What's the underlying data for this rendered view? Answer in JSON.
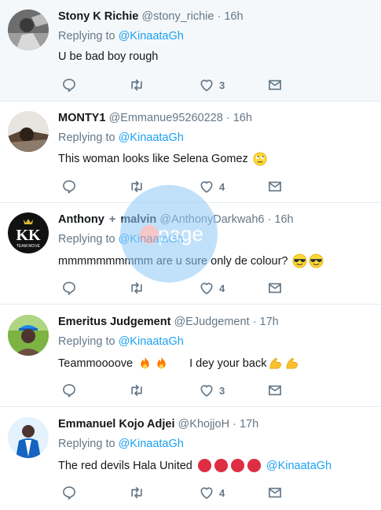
{
  "tweets": [
    {
      "name": "Stony K Richie",
      "handle": "@stony_richie",
      "time": "16h",
      "replying_label": "Replying to",
      "replying_to": "@KinaataGh",
      "text": "U be bad boy rough",
      "like_count": "3"
    },
    {
      "name": "MONTY1",
      "handle": "@Emmanue95260228",
      "time": "16h",
      "replying_label": "Replying to",
      "replying_to": "@KinaataGh",
      "text": "This woman looks like Selena Gomez",
      "emoji": "rolling-eyes",
      "like_count": "4"
    },
    {
      "name": "Anthony",
      "name_suffix": "malvin",
      "handle": "@AnthonyDarkwah6",
      "time": "16h",
      "replying_label": "Replying to",
      "replying_to": "@KinaataGh",
      "text": "mmmmmmmmmm are u sure only de colour?",
      "emoji": "sunglasses x2",
      "like_count": "4"
    },
    {
      "name": "Emeritus Judgement",
      "handle": "@EJudgement",
      "time": "17h",
      "replying_label": "Replying to",
      "replying_to": "@KinaataGh",
      "text": "Teammoooove",
      "text2": "I dey your back",
      "emoji": "fire x2, flexed-biceps x2",
      "like_count": "3"
    },
    {
      "name": "Emmanuel Kojo Adjei",
      "handle": "@KhojjoH",
      "time": "17h",
      "replying_label": "Replying to",
      "replying_to": "@KinaataGh",
      "text": "The red devils Hala United",
      "emoji": "red-circle x4",
      "text_mention": "@KinaataGh",
      "like_count": "4"
    }
  ],
  "separator": "·",
  "avatar_logo_text": "TEAM MOVE",
  "watermark_text": "page",
  "icons": [
    "reply-icon",
    "retweet-icon",
    "like-icon",
    "direct-message-icon"
  ],
  "colors": {
    "accent": "#1da1f2",
    "muted": "#657786",
    "highlight_bg": "#f5f8fa"
  }
}
